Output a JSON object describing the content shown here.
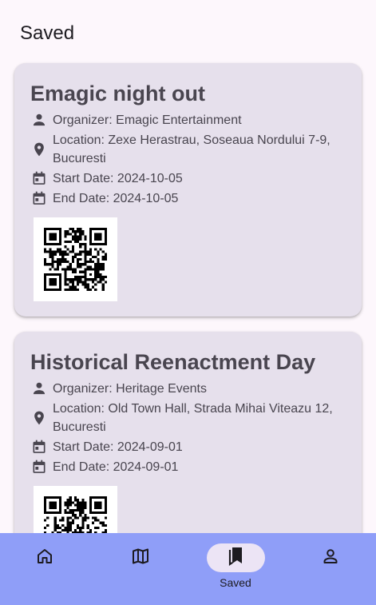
{
  "header": {
    "title": "Saved"
  },
  "events": [
    {
      "title": "Emagic night out",
      "organizer": "Organizer: Emagic Entertainment",
      "location": "Location: Zexe Herastrau, Soseaua Nordului 7-9, Bucuresti",
      "start": "Start Date: 2024-10-05",
      "end": "End Date: 2024-10-05"
    },
    {
      "title": "Historical Reenactment Day",
      "organizer": "Organizer: Heritage Events",
      "location": "Location: Old Town Hall, Strada Mihai Viteazu 12, Bucuresti",
      "start": "Start Date: 2024-09-01",
      "end": "End Date: 2024-09-01"
    }
  ],
  "nav": {
    "items": [
      {
        "icon": "home-icon",
        "label": ""
      },
      {
        "icon": "map-icon",
        "label": ""
      },
      {
        "icon": "bookmarks-icon",
        "label": "Saved",
        "active": true
      },
      {
        "icon": "person-icon",
        "label": ""
      }
    ]
  },
  "colors": {
    "background": "#fdf7fc",
    "card": "#e6e0ec",
    "text_secondary": "#49454f",
    "nav_bar": "#8f9ef8",
    "nav_active_pill": "#ece4f5"
  }
}
